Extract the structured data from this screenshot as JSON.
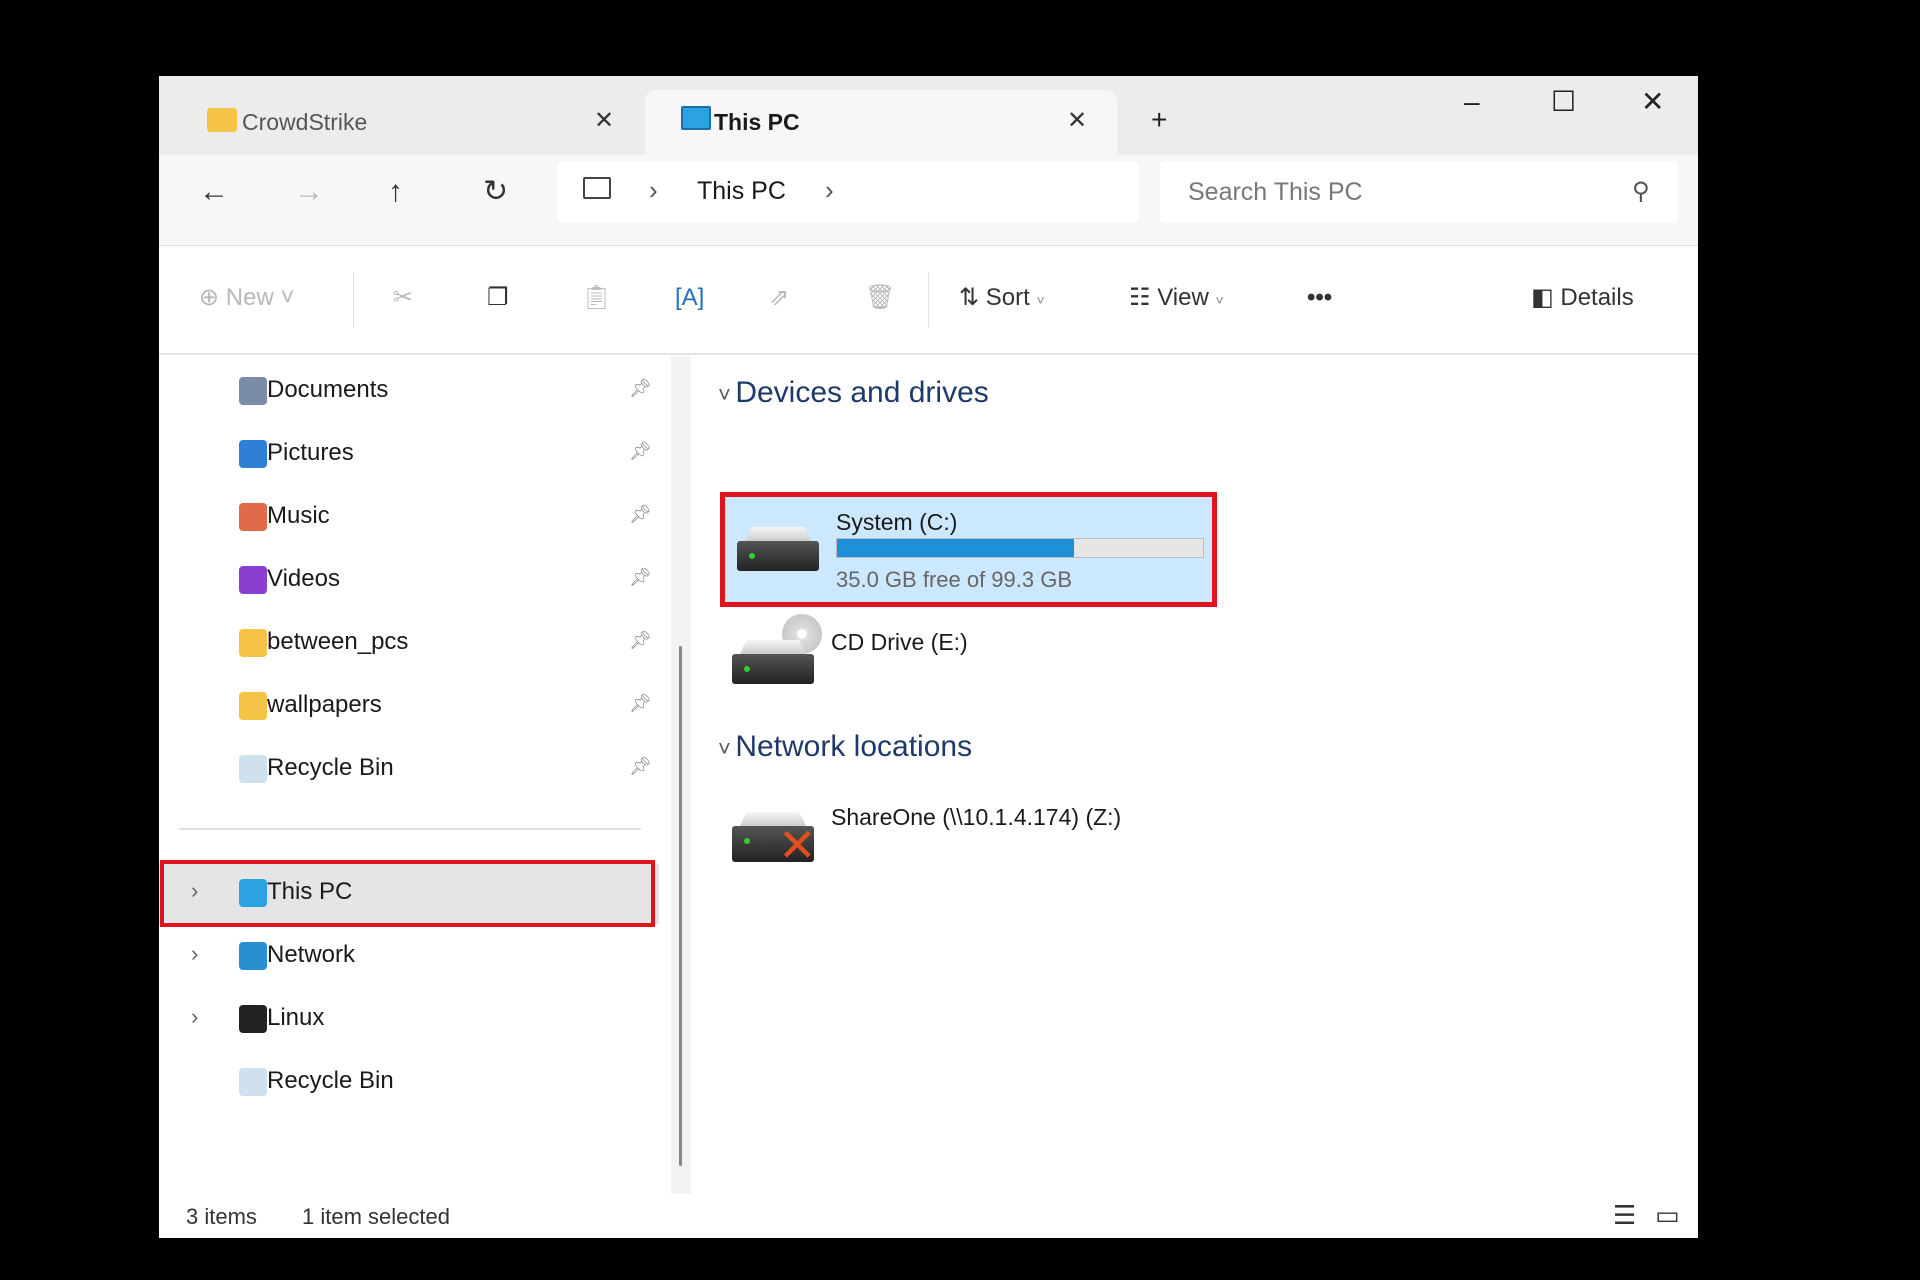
{
  "tabs": [
    {
      "label": "CrowdStrike",
      "icon": "folder-icon",
      "active": false
    },
    {
      "label": "This PC",
      "icon": "monitor-icon",
      "active": true
    }
  ],
  "window_controls": {
    "minimize": "–",
    "maximize": "☐",
    "close": "✕",
    "new_tab": "+",
    "tab_close": "✕"
  },
  "nav": {
    "back": "←",
    "forward": "→",
    "up": "↑",
    "refresh": "↻"
  },
  "address": {
    "segments": [
      "This PC"
    ],
    "chevron": "›"
  },
  "search": {
    "placeholder": "Search This PC"
  },
  "toolbar": {
    "new": "New",
    "sort": "Sort",
    "view": "View",
    "more": "•••",
    "details": "Details"
  },
  "sidebar": {
    "pinned": [
      {
        "label": "Documents",
        "icon": "documents-icon",
        "color": "#7a8ca8"
      },
      {
        "label": "Pictures",
        "icon": "pictures-icon",
        "color": "#2f7fd6"
      },
      {
        "label": "Music",
        "icon": "music-icon",
        "color": "#e06a4a"
      },
      {
        "label": "Videos",
        "icon": "videos-icon",
        "color": "#8a3fd0"
      },
      {
        "label": "between_pcs",
        "icon": "folder-icon",
        "color": "#f6c445"
      },
      {
        "label": "wallpapers",
        "icon": "folder-icon",
        "color": "#f6c445"
      },
      {
        "label": "Recycle Bin",
        "icon": "recycle-bin-icon",
        "color": "#cfe0ee"
      }
    ],
    "tree": [
      {
        "label": "This PC",
        "icon": "monitor-icon",
        "color": "#2aa3e0",
        "expandable": true,
        "selected": true
      },
      {
        "label": "Network",
        "icon": "network-icon",
        "color": "#2a8fd0",
        "expandable": true
      },
      {
        "label": "Linux",
        "icon": "linux-penguin-icon",
        "color": "#222",
        "expandable": true
      },
      {
        "label": "Recycle Bin",
        "icon": "recycle-bin-icon",
        "color": "#cfe0ee",
        "expandable": false
      }
    ]
  },
  "content": {
    "groups": [
      {
        "title": "Devices and drives",
        "items": [
          {
            "name": "System (C:)",
            "free_text": "35.0 GB free of 99.3 GB",
            "used_fraction": 0.648,
            "selected": true
          },
          {
            "name": "CD Drive (E:)"
          }
        ]
      },
      {
        "title": "Network locations",
        "items": [
          {
            "name": "ShareOne (\\\\10.1.4.174) (Z:)",
            "disconnected": true
          }
        ]
      }
    ]
  },
  "status": {
    "count": "3 items",
    "selection": "1 item selected"
  },
  "colors": {
    "highlight_box": "#e0141e",
    "selection": "#cce8ff",
    "progress": "#1e90d8"
  }
}
